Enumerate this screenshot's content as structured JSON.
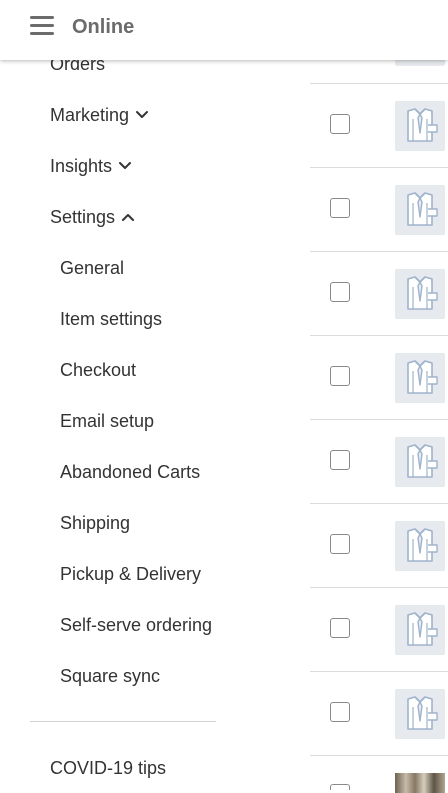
{
  "header": {
    "title": "Online"
  },
  "nav": {
    "items": [
      {
        "label": "Orders"
      },
      {
        "label": "Marketing",
        "expanded": false
      },
      {
        "label": "Insights",
        "expanded": false
      },
      {
        "label": "Settings",
        "expanded": true
      }
    ],
    "settings_subitems": [
      {
        "label": "General"
      },
      {
        "label": "Item settings"
      },
      {
        "label": "Checkout"
      },
      {
        "label": "Email setup"
      },
      {
        "label": "Abandoned Carts"
      },
      {
        "label": "Shipping"
      },
      {
        "label": "Pickup & Delivery"
      },
      {
        "label": "Self-serve ordering"
      },
      {
        "label": "Square sync"
      }
    ],
    "footer_item": {
      "label": "COVID-19 tips"
    }
  },
  "item_list": {
    "rows": [
      {
        "checked": false,
        "thumbnail": "shirt-placeholder-icon"
      },
      {
        "checked": false,
        "thumbnail": "shirt-placeholder-icon"
      },
      {
        "checked": false,
        "thumbnail": "shirt-placeholder-icon"
      },
      {
        "checked": false,
        "thumbnail": "shirt-placeholder-icon"
      },
      {
        "checked": false,
        "thumbnail": "shirt-placeholder-icon"
      },
      {
        "checked": false,
        "thumbnail": "shirt-placeholder-icon"
      },
      {
        "checked": false,
        "thumbnail": "shirt-placeholder-icon"
      },
      {
        "checked": false,
        "thumbnail": "shirt-placeholder-icon"
      },
      {
        "checked": false,
        "thumbnail": "product-photo"
      }
    ]
  },
  "colors": {
    "text": "#333333",
    "header_text": "#6b6b6b",
    "divider": "#dcdcdc",
    "thumbnail_bg": "#e6e9ee",
    "icon_stroke": "#9fb3cb"
  }
}
